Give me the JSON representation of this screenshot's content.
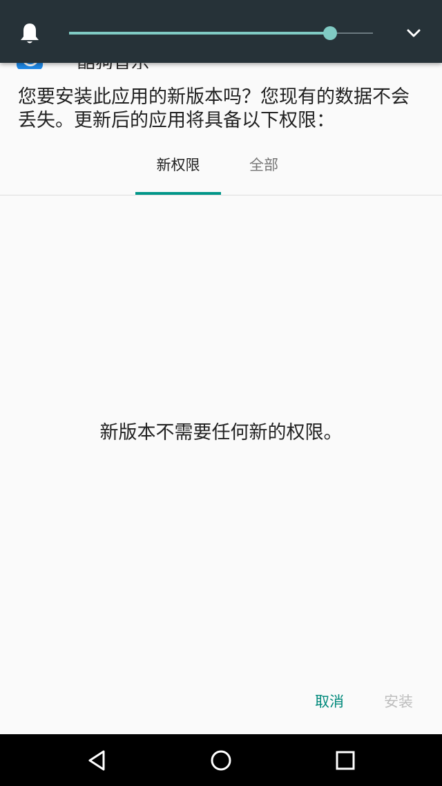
{
  "status_panel": {
    "icons": [
      "bell-icon",
      "chevron-down-icon"
    ],
    "volume_level": 0.86,
    "accent_color": "#80cbc4",
    "background_color": "#263238"
  },
  "app": {
    "name": "酷狗音乐"
  },
  "prompt_text": "您要安装此应用的新版本吗？您现有的数据不会丢失。更新后的应用将具备以下权限：",
  "tabs": [
    {
      "label": "新权限",
      "selected": true
    },
    {
      "label": "全部",
      "selected": false
    }
  ],
  "message": "新版本不需要任何新的权限。",
  "buttons": {
    "cancel": "取消",
    "install": "安装"
  },
  "colors": {
    "accent": "#009688",
    "disabled": "#bdbdbd"
  },
  "navigation": {
    "icons": [
      "back-icon",
      "home-icon",
      "recents-icon"
    ]
  }
}
